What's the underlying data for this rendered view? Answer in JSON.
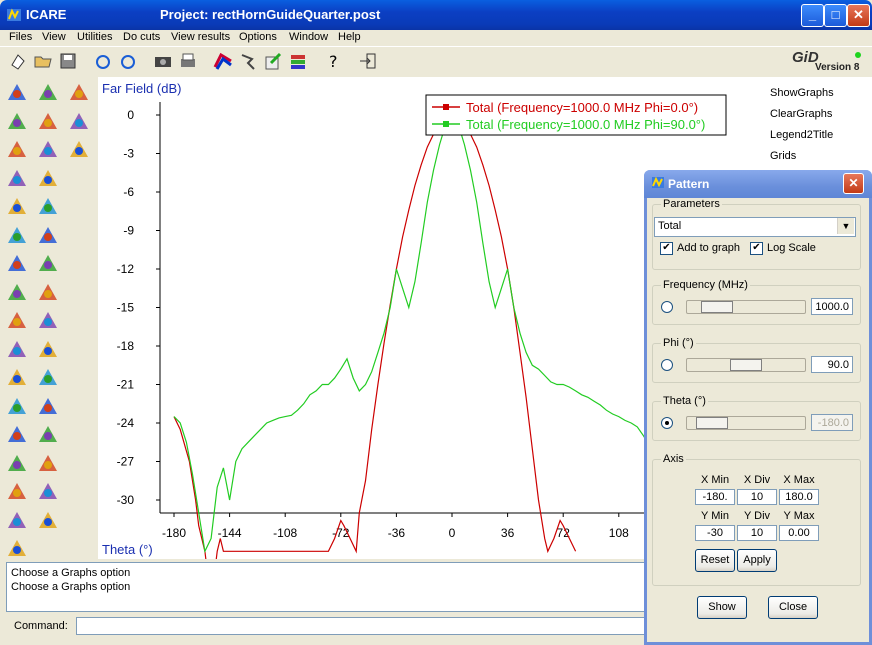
{
  "window": {
    "app_name": "ICARE",
    "project_title": "Project: rectHornGuideQuarter.post",
    "minimize_label": "_",
    "maximize_label": "□",
    "close_label": "✕"
  },
  "menu": [
    "Files",
    "View",
    "Utilities",
    "Do cuts",
    "View results",
    "Options",
    "Window",
    "Help"
  ],
  "gid": {
    "logo": "GiD",
    "version": "Version 8"
  },
  "side_list": [
    "ShowGraphs",
    "ClearGraphs",
    "Legend2Title",
    "Grids"
  ],
  "messages": [
    "Choose a Graphs option",
    "Choose a Graphs option"
  ],
  "command_label": "Command:",
  "chart_data": {
    "type": "line",
    "ylabel": "Far Field (dB)",
    "xlabel": "Theta (°)",
    "xlim": [
      -180,
      180
    ],
    "ylim": [
      -30,
      0
    ],
    "xticks": [
      "-180",
      "-144",
      "-108",
      "-72",
      "-36",
      "0",
      "36",
      "72",
      "108"
    ],
    "yticks": [
      "0",
      "-3",
      "-6",
      "-9",
      "-12",
      "-15",
      "-18",
      "-21",
      "-24",
      "-27",
      "-30"
    ],
    "series": [
      {
        "name": "Total (Frequency=1000.0 MHz Phi=0.0°)",
        "color": "#cc0000",
        "x": [
          -180,
          -176,
          -170,
          -166,
          -164,
          -160,
          -156,
          -152,
          -150,
          -148,
          -80,
          -76,
          -72,
          -70,
          -66,
          -62,
          -60,
          -56,
          -52,
          -48,
          -44,
          -40,
          -36,
          -32,
          -28,
          -24,
          -20,
          -16,
          -12,
          -8,
          -4,
          0,
          4,
          8,
          12,
          16,
          20,
          24,
          28,
          32,
          36,
          40,
          44,
          48,
          52,
          56,
          60,
          62,
          66,
          70,
          72,
          76,
          80
        ],
        "y": [
          -23.5,
          -24.5,
          -27,
          -30,
          -32,
          -34,
          -38,
          -34,
          -33,
          -34,
          -34,
          -33,
          -31.6,
          -32,
          -33,
          -34,
          -31,
          -28.5,
          -24.5,
          -21,
          -17.8,
          -14.8,
          -12,
          -9.5,
          -7.4,
          -5.5,
          -3.9,
          -2.5,
          -1.5,
          -0.7,
          -0.2,
          0,
          -0.2,
          -0.7,
          -1.5,
          -2.5,
          -3.9,
          -5.5,
          -7.4,
          -9.5,
          -12,
          -15,
          -18.5,
          -22,
          -26,
          -30,
          -33,
          -34,
          -33,
          -31.6,
          -32,
          -33,
          -34
        ]
      },
      {
        "name": "Total (Frequency=1000.0 MHz Phi=90.0°)",
        "color": "#22cc22",
        "x": [
          -180,
          -176,
          -172,
          -168,
          -164,
          -160,
          -156,
          -152,
          -148,
          -144,
          -140,
          -136,
          -132,
          -128,
          -124,
          -120,
          -116,
          -112,
          -108,
          -104,
          -100,
          -96,
          -92,
          -88,
          -84,
          -80,
          -76,
          -72,
          -68,
          -64,
          -60,
          -56,
          -52,
          -48,
          -44,
          -40,
          -36,
          -32,
          -28,
          -24,
          -20,
          -16,
          -12,
          -8,
          -4,
          0,
          4,
          8,
          12,
          16,
          20,
          24,
          28,
          32,
          36,
          40,
          44,
          48,
          52,
          56,
          60,
          64,
          68,
          72,
          76,
          80,
          84,
          88,
          92,
          96,
          100,
          104,
          108,
          112,
          116,
          120,
          124,
          128,
          132,
          136
        ],
        "y": [
          -23.5,
          -24,
          -25.5,
          -28,
          -31,
          -34,
          -33,
          -29,
          -27.5,
          -30,
          -27,
          -26,
          -25.5,
          -25,
          -24.5,
          -24,
          -23.8,
          -23.6,
          -23.5,
          -23.4,
          -23,
          -22.5,
          -21.8,
          -21.5,
          -21,
          -21,
          -20.5,
          -19.8,
          -19,
          -20.5,
          -21.5,
          -21,
          -20,
          -18.5,
          -17,
          -15,
          -12,
          -13.5,
          -15,
          -13,
          -10,
          -6.8,
          -4.3,
          -2.3,
          -0.7,
          0,
          -0.7,
          -2.3,
          -4.3,
          -6.8,
          -10,
          -13,
          -15,
          -13.5,
          -12,
          -15,
          -17,
          -18.5,
          -19.5,
          -19.8,
          -20.3,
          -20.8,
          -21,
          -21,
          -21.2,
          -21.5,
          -21.8,
          -22,
          -22.3,
          -22.6,
          -23,
          -23.3,
          -23.5,
          -23.8,
          -24,
          -24.3,
          -25,
          -25.8,
          -26.8,
          -27
        ]
      }
    ],
    "grid": false,
    "legend": "top-right"
  },
  "dialog": {
    "title": "Pattern",
    "close_label": "✕",
    "parameters_label": "Parameters",
    "select_value": "Total",
    "add_to_graph_label": "Add to graph",
    "add_to_graph": true,
    "log_scale_label": "Log Scale",
    "log_scale": true,
    "frequency_label": "Frequency (MHz)",
    "frequency_value": "1000.0",
    "frequency_slider": 0.15,
    "phi_label": "Phi (°)",
    "phi_value": "90.0",
    "phi_slider": 0.5,
    "theta_label": "Theta (°)",
    "theta_value": "-180.0",
    "theta_slider": 0.1,
    "axis_label": "Axis",
    "xmin_label": "X Min",
    "xdiv_label": "X Div",
    "xmax_label": "X Max",
    "xmin": "-180.",
    "xdiv": "10",
    "xmax": "180.0",
    "ymin_label": "Y Min",
    "ydiv_label": "Y Div",
    "ymax_label": "Y Max",
    "ymin": "-30",
    "ydiv": "10",
    "ymax": "0.00",
    "reset_label": "Reset",
    "apply_label": "Apply",
    "show_label": "Show",
    "close_btn_label": "Close"
  }
}
